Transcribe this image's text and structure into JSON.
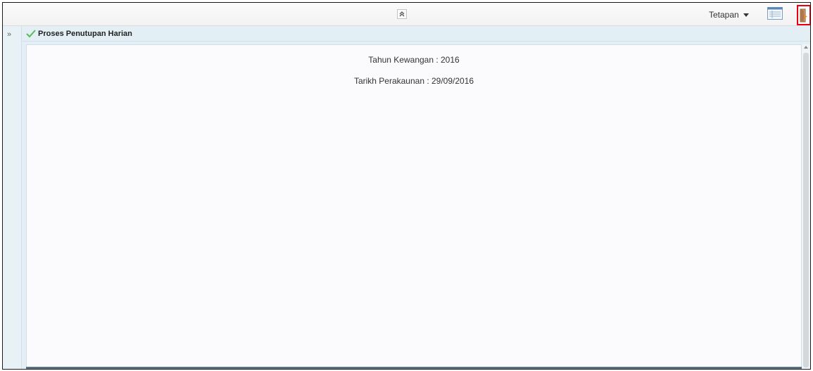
{
  "toolbar": {
    "collapse_icon": "double-chevron-up-icon",
    "settings_label": "Tetapan",
    "list_view_icon": "list-view-icon",
    "logout_icon": "exit-door-icon",
    "highlight_color": "#e60012"
  },
  "sidebar": {
    "expand_icon": "double-chevron-right-icon",
    "expand_glyph": "»"
  },
  "panel": {
    "title": "Proses Penutupan Harian",
    "status_icon": "check-icon",
    "status_color": "#5cb85c"
  },
  "content": {
    "financial_year_label": "Tahun Kewangan : 2016",
    "accounting_date_label": "Tarikh Perakaunan : 29/09/2016"
  }
}
